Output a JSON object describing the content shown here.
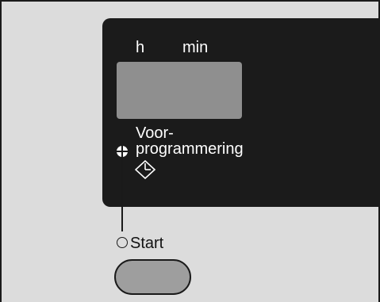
{
  "display": {
    "hours_label": "h",
    "minutes_label": "min"
  },
  "delay_start": {
    "label_line1": "Voor-",
    "label_line2": "programmering",
    "icon": "clock-delay-icon"
  },
  "start": {
    "label": "Start"
  },
  "colors": {
    "panel": "#1b1b1b",
    "lcd": "#8f8f8f",
    "background": "#dcdcdc",
    "button": "#9e9e9e"
  }
}
